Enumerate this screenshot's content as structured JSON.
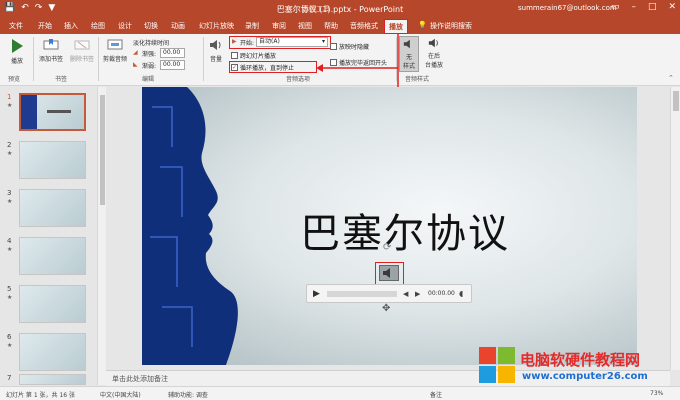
{
  "titlebar": {
    "document_title": "巴塞尔协议 (1).pptx - PowerPoint",
    "context_tab_group": "音频工具",
    "account": "summerain67@outlook.com",
    "qat": [
      "💾",
      "↶",
      "↷",
      "▼"
    ]
  },
  "tabs": [
    {
      "label": "文件"
    },
    {
      "label": "开始"
    },
    {
      "label": "插入"
    },
    {
      "label": "绘图"
    },
    {
      "label": "设计"
    },
    {
      "label": "切换"
    },
    {
      "label": "动画"
    },
    {
      "label": "幻灯片放映"
    },
    {
      "label": "录制"
    },
    {
      "label": "审阅"
    },
    {
      "label": "视图"
    },
    {
      "label": "帮助"
    },
    {
      "label": "音频格式"
    },
    {
      "label": "播放"
    },
    {
      "label": "操作说明搜索"
    }
  ],
  "ribbon": {
    "play_label": "播放",
    "preview_group": "预览",
    "add_bookmark": "添加书签",
    "remove_bookmark": "删除书签",
    "bookmarks_group": "书签",
    "trim_audio": "剪裁音频",
    "fade_duration": "淡化持续时间",
    "fade_in_label": "渐强:",
    "fade_in_value": "00.00",
    "fade_out_label": "渐弱:",
    "fade_out_value": "00.00",
    "edit_group": "编辑",
    "volume": "音量",
    "start_label": "开始:",
    "start_value": "自动(A)",
    "cross_slides": "跨幻灯片播放",
    "loop_until_stop": "循环播放，直到停止",
    "hide_during_show": "放映时隐藏",
    "rewind_after": "播放完毕返回开头",
    "audio_options_group": "音频选项",
    "no_style_line1": "无",
    "no_style_line2": "样式",
    "bg_play_line1": "在后",
    "bg_play_line2": "台播放",
    "audio_styles_group": "音频样式"
  },
  "thumbnails": [
    {
      "num": "1",
      "star": "★"
    },
    {
      "num": "2",
      "star": "★"
    },
    {
      "num": "3",
      "star": "★"
    },
    {
      "num": "4",
      "star": "★"
    },
    {
      "num": "5",
      "star": "★"
    },
    {
      "num": "6",
      "star": "★"
    },
    {
      "num": "7",
      "star": ""
    }
  ],
  "slide": {
    "title": "巴塞尔协议",
    "audio_time": "00:00.00"
  },
  "notes_placeholder": "单击此处添加备注",
  "status": {
    "slide_count": "幻灯片 第 1 张，共 16 张",
    "language": "中文(中国大陆)",
    "accessibility": "辅助功能: 调查",
    "notes_btn": "备注",
    "zoom": "73%"
  },
  "watermark": {
    "site_name": "电脑软硬件教程网",
    "url": "www.computer26.com"
  },
  "colors": {
    "brand": "#b7472a",
    "highlight": "#e02020"
  }
}
